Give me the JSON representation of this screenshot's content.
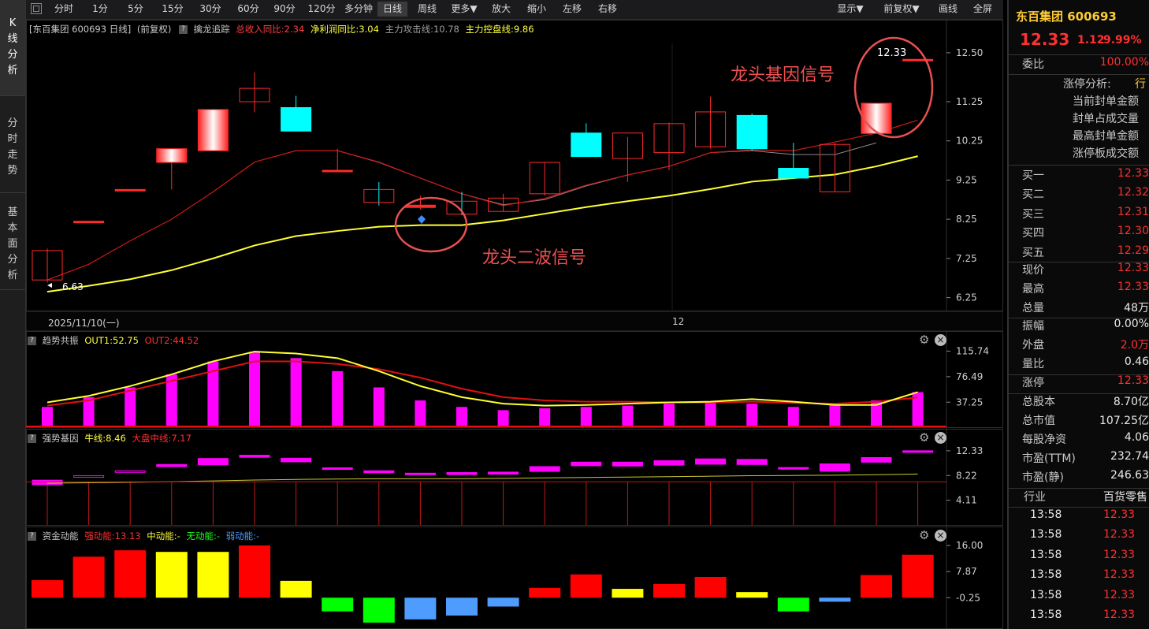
{
  "colors": {
    "up": "#ff2a2a",
    "down": "#00ffff",
    "ma_short": "#d01818",
    "ma_gray": "#8c8c8c",
    "ma_yellow": "#ffff33",
    "magenta": "#ff00ff",
    "gold": "#ffff00"
  },
  "toolbar": {
    "items": [
      "分时",
      "1分",
      "5分",
      "15分",
      "30分",
      "60分",
      "90分",
      "120分",
      "多分钟",
      "日线",
      "周线",
      "更多▼",
      "放大",
      "缩小",
      "左移",
      "右移"
    ],
    "active": "日线",
    "right_items": [
      "显示▼",
      "前复权▼",
      "画线",
      "全屏"
    ]
  },
  "left_tabs": [
    {
      "label": "K线分析",
      "active": true
    },
    {
      "label": "分时走势",
      "active": false
    },
    {
      "label": "基本面分析",
      "active": false
    }
  ],
  "main_pane": {
    "stock_label": "[东百集团 600693 日线]",
    "adjust": "(前复权)",
    "indicator_name": "擒龙追踪",
    "revenue_yoy": "总收入同比:2.34",
    "profit_yoy": "净利润同比:3.04",
    "attack_line": "主力攻击线:10.78",
    "control_line": "主力控盘线:9.86",
    "y_ticks": [
      "12.50",
      "11.25",
      "10.25",
      "9.25",
      "8.25",
      "7.25",
      "6.25"
    ],
    "date_left": "2025/11/10(一)",
    "date_mid": "12",
    "low_label": "6.63",
    "high_label": "12.33",
    "annot_gene": "龙头基因信号",
    "annot_wave": "龙头二波信号"
  },
  "chart_data": {
    "type": "candlestick",
    "candles": [
      {
        "o": 6.7,
        "h": 7.5,
        "l": 6.63,
        "c": 7.45
      },
      {
        "o": 8.2,
        "h": 8.2,
        "l": 8.2,
        "c": 8.2
      },
      {
        "o": 9.01,
        "h": 9.01,
        "l": 9.01,
        "c": 9.01
      },
      {
        "o": 9.7,
        "h": 10.0,
        "l": 9.01,
        "c": 10.05
      },
      {
        "o": 10.0,
        "h": 11.05,
        "l": 10.0,
        "c": 11.05
      },
      {
        "o": 11.25,
        "h": 12.0,
        "l": 10.98,
        "c": 11.59
      },
      {
        "o": 11.1,
        "h": 11.4,
        "l": 10.5,
        "c": 10.5
      },
      {
        "o": 9.5,
        "h": 10.05,
        "l": 9.45,
        "c": 9.5
      },
      {
        "o": 9.01,
        "h": 9.2,
        "l": 8.6,
        "c": 8.68
      },
      {
        "o": 8.55,
        "h": 8.85,
        "l": 8.5,
        "c": 8.61
      },
      {
        "o": 8.71,
        "h": 8.95,
        "l": 8.35,
        "c": 8.38
      },
      {
        "o": 8.45,
        "h": 8.9,
        "l": 8.45,
        "c": 8.79
      },
      {
        "o": 8.9,
        "h": 9.7,
        "l": 8.85,
        "c": 9.7
      },
      {
        "o": 10.45,
        "h": 10.7,
        "l": 9.85,
        "c": 9.85
      },
      {
        "o": 9.8,
        "h": 10.35,
        "l": 9.2,
        "c": 10.45
      },
      {
        "o": 9.95,
        "h": 10.72,
        "l": 9.5,
        "c": 10.69
      },
      {
        "o": 10.1,
        "h": 11.38,
        "l": 10.05,
        "c": 10.99
      },
      {
        "o": 10.9,
        "h": 10.95,
        "l": 10.0,
        "c": 10.05
      },
      {
        "o": 9.55,
        "h": 10.2,
        "l": 9.3,
        "c": 9.3
      },
      {
        "o": 8.95,
        "h": 10.2,
        "l": 8.95,
        "c": 10.16
      },
      {
        "o": 10.44,
        "h": 11.21,
        "l": 10.44,
        "c": 11.21
      },
      {
        "o": 12.33,
        "h": 12.33,
        "l": 12.33,
        "c": 12.33
      }
    ],
    "ma_red": [
      6.7,
      7.1,
      7.7,
      8.25,
      8.95,
      9.71,
      10.0,
      10.0,
      9.71,
      9.3,
      8.9,
      8.6,
      8.78,
      9.12,
      9.38,
      9.6,
      9.95,
      10.02,
      10.0,
      10.22,
      10.45,
      10.78
    ],
    "ma_gray": [
      null,
      null,
      null,
      null,
      null,
      null,
      10.0,
      10.0,
      9.7,
      9.3,
      8.9,
      8.62,
      8.75,
      9.1,
      9.38,
      9.6,
      9.95,
      10.0,
      9.9,
      9.9,
      10.2,
      null
    ],
    "ma_yellow": [
      6.4,
      6.55,
      6.72,
      6.95,
      7.25,
      7.58,
      7.82,
      7.95,
      8.06,
      8.1,
      8.1,
      8.22,
      8.39,
      8.56,
      8.71,
      8.85,
      9.02,
      9.21,
      9.3,
      9.39,
      9.6,
      9.86
    ],
    "ylim": [
      6.0,
      12.9
    ]
  },
  "trend_pane": {
    "title": "趋势共振",
    "out1": "OUT1:52.75",
    "out2": "OUT2:44.52",
    "y_ticks": [
      "115.74",
      "76.49",
      "37.25"
    ],
    "bars": [
      30,
      45,
      60,
      80,
      100,
      115,
      105,
      85,
      60,
      40,
      30,
      25,
      28,
      30,
      32,
      35,
      38,
      35,
      30,
      33,
      40,
      52.75
    ],
    "line_yellow": [
      37,
      47,
      62,
      80,
      100,
      115,
      112,
      105,
      85,
      62,
      45,
      35,
      32,
      33,
      35,
      37,
      38,
      42,
      38,
      33,
      33,
      52.75
    ],
    "line_red": [
      32,
      40,
      55,
      70,
      85,
      100,
      100,
      96,
      88,
      75,
      58,
      45,
      40,
      38,
      38,
      37,
      37,
      38,
      36,
      35,
      38,
      44.52
    ],
    "ylim": [
      0,
      126
    ]
  },
  "gene_pane": {
    "title": "强势基因",
    "ox_line": "牛线:8.46",
    "mid_line": "大盘中线:7.17",
    "y_ticks": [
      "12.33",
      "8.22",
      "4.11"
    ],
    "ylim": [
      0,
      13.5
    ]
  },
  "fund_pane": {
    "title": "资金动能",
    "strong": "强动能:13.13",
    "mid": "中动能:-",
    "none": "无动能:-",
    "weak": "弱动能:-",
    "y_ticks": [
      "16.00",
      "7.87",
      "-0.25"
    ],
    "bars": [
      {
        "v": 5.2,
        "c": "red"
      },
      {
        "v": 12.5,
        "c": "red"
      },
      {
        "v": 14.5,
        "c": "red"
      },
      {
        "v": 14.0,
        "c": "yellow"
      },
      {
        "v": 14.0,
        "c": "yellow"
      },
      {
        "v": 16.0,
        "c": "red"
      },
      {
        "v": 5.0,
        "c": "yellow"
      },
      {
        "v": -4.5,
        "c": "green"
      },
      {
        "v": -8.0,
        "c": "green"
      },
      {
        "v": -7.0,
        "c": "blue"
      },
      {
        "v": -5.8,
        "c": "blue"
      },
      {
        "v": -3.0,
        "c": "blue"
      },
      {
        "v": 2.8,
        "c": "red"
      },
      {
        "v": 7.0,
        "c": "red"
      },
      {
        "v": 2.5,
        "c": "yellow"
      },
      {
        "v": 4.0,
        "c": "red"
      },
      {
        "v": 6.2,
        "c": "red"
      },
      {
        "v": 1.5,
        "c": "yellow"
      },
      {
        "v": -4.5,
        "c": "green"
      },
      {
        "v": -1.5,
        "c": "blue"
      },
      {
        "v": 6.8,
        "c": "red"
      },
      {
        "v": 13.13,
        "c": "red"
      }
    ],
    "ylim": [
      -9.5,
      16.5
    ]
  },
  "right_panel": {
    "name": "东百集团 600693",
    "price": "12.33",
    "change": "1.12",
    "pct": "9.99%",
    "wei_label": "委比",
    "wei_val": "100.00%",
    "limit_items": [
      "涨停分析:",
      "当前封单金额",
      "封单占成交量",
      "最高封单金额",
      "涨停板成交额"
    ],
    "limit_tag": "行",
    "bids": [
      {
        "label": "买一",
        "val": "12.33"
      },
      {
        "label": "买二",
        "val": "12.32"
      },
      {
        "label": "买三",
        "val": "12.31"
      },
      {
        "label": "买四",
        "val": "12.30"
      },
      {
        "label": "买五",
        "val": "12.29"
      }
    ],
    "stats1": [
      {
        "label": "现价",
        "val": "12.33",
        "color": "#ff3030"
      },
      {
        "label": "最高",
        "val": "12.33",
        "color": "#ff3030"
      },
      {
        "label": "总量",
        "val": "48万",
        "color": "#e8e8e8"
      }
    ],
    "stats2": [
      {
        "label": "振幅",
        "val": "0.00%",
        "color": "#e8e8e8"
      },
      {
        "label": "外盘",
        "val": "2.0万",
        "color": "#ff3030"
      },
      {
        "label": "量比",
        "val": "0.46",
        "color": "#e8e8e8"
      }
    ],
    "zt": {
      "label": "涨停",
      "val": "12.33"
    },
    "fund": [
      {
        "label": "总股本",
        "val": "8.70亿"
      },
      {
        "label": "总市值",
        "val": "107.25亿"
      },
      {
        "label": "每股净资",
        "val": "4.06"
      },
      {
        "label": "市盈(TTM)",
        "val": "232.74"
      },
      {
        "label": "市盈(静)",
        "val": "246.63"
      }
    ],
    "industry_label": "行业",
    "industry_val": "百货零售",
    "ticks": [
      {
        "t": "13:58",
        "p": "12.33"
      },
      {
        "t": "13:58",
        "p": "12.33"
      },
      {
        "t": "13:58",
        "p": "12.33"
      },
      {
        "t": "13:58",
        "p": "12.33"
      },
      {
        "t": "13:58",
        "p": "12.33"
      },
      {
        "t": "13:58",
        "p": "12.33"
      }
    ]
  }
}
